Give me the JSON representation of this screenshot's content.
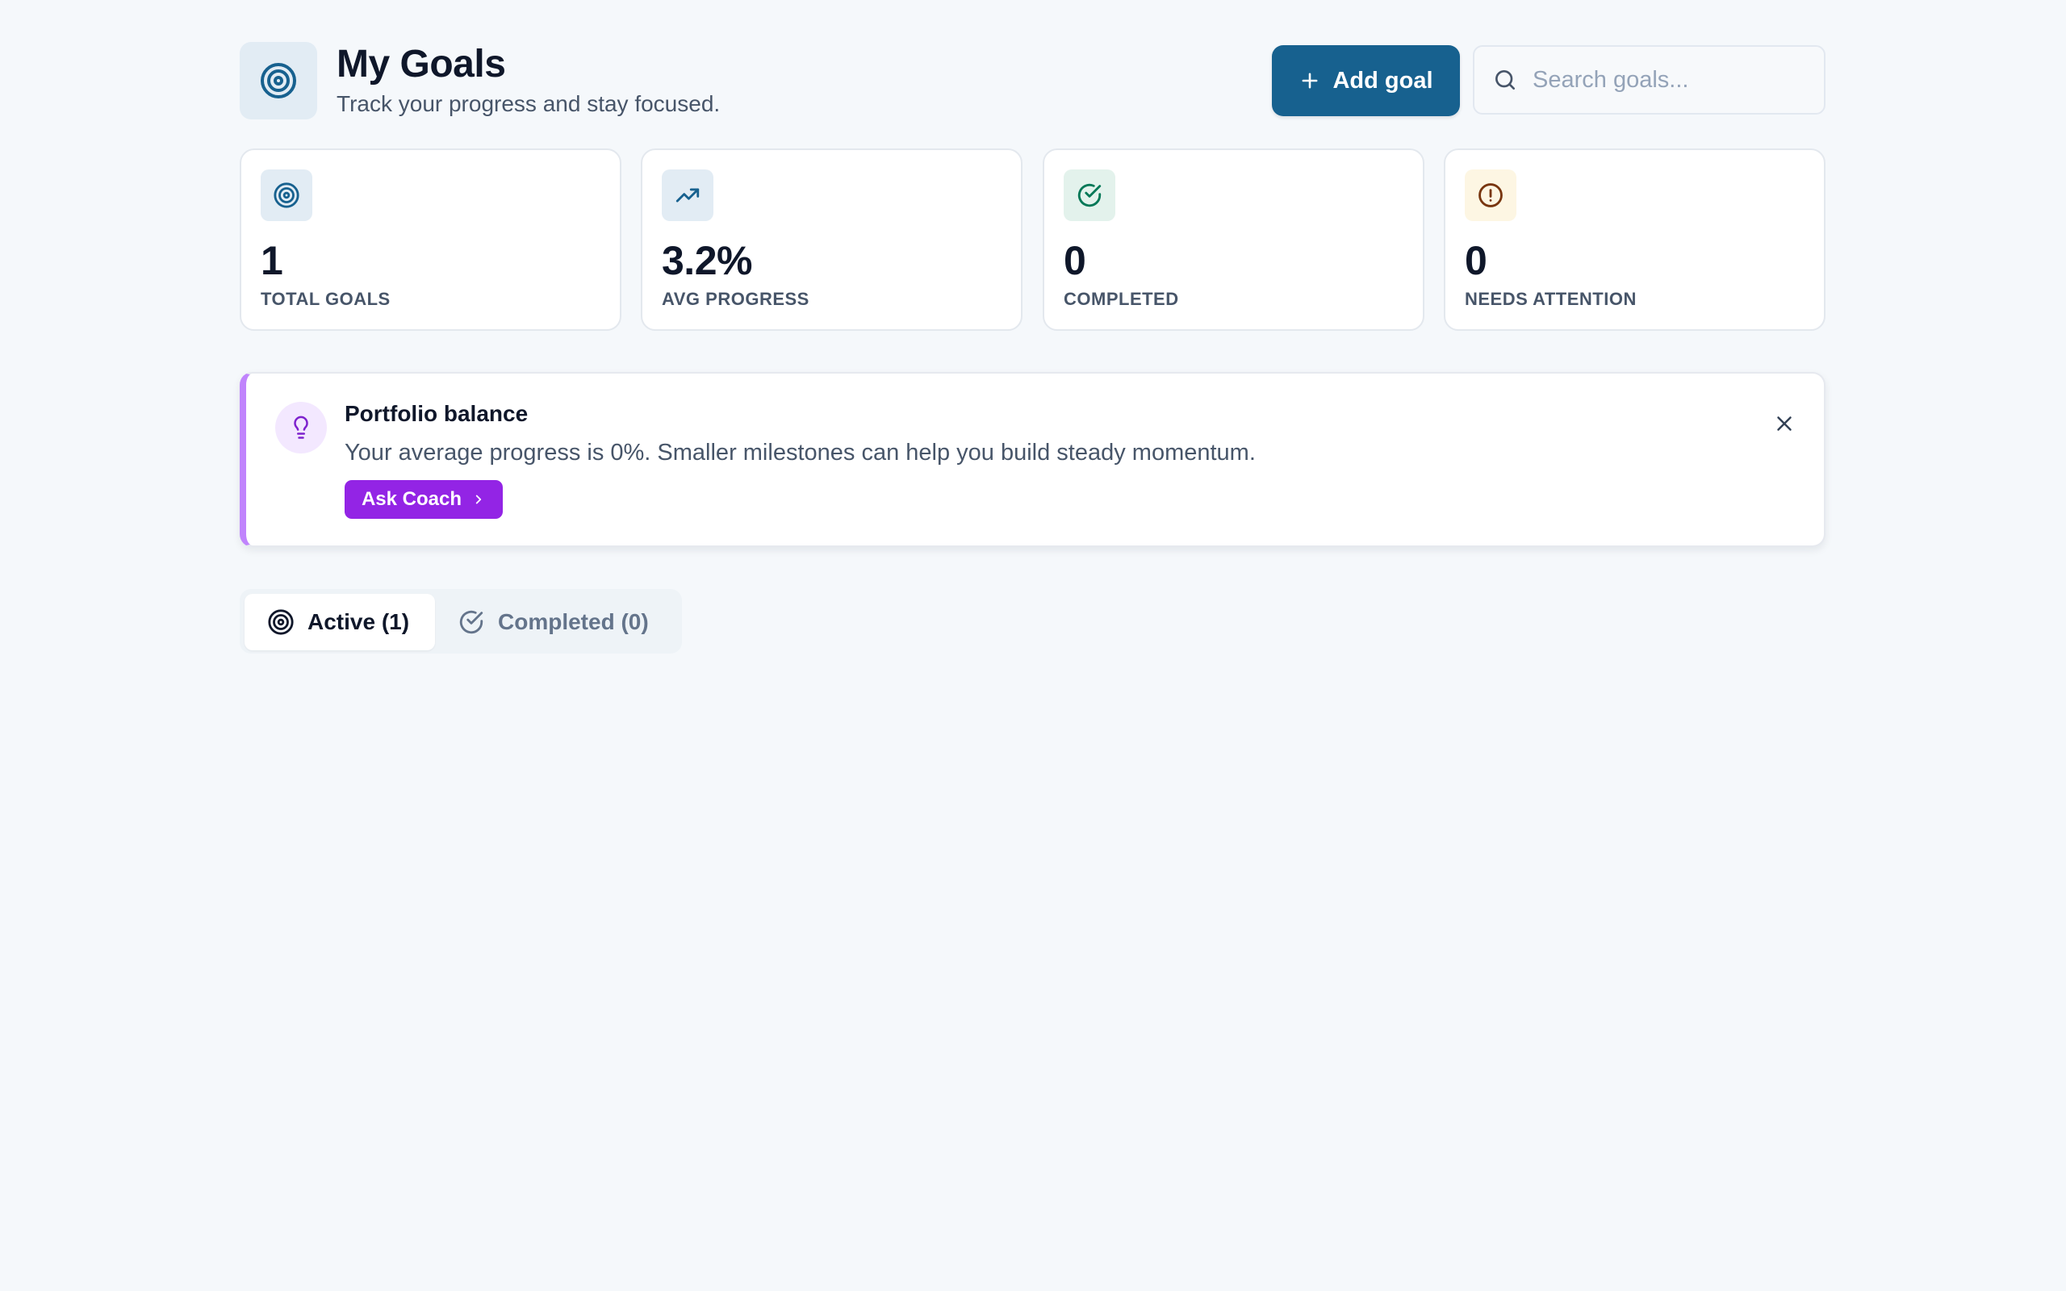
{
  "header": {
    "title": "My Goals",
    "subtitle": "Track your progress and stay focused.",
    "add_label": "Add goal",
    "search_placeholder": "Search goals..."
  },
  "stats": [
    {
      "icon": "target-icon",
      "value": "1",
      "label": "TOTAL GOALS",
      "color": "#17618f",
      "bg": "#e2ecf4"
    },
    {
      "icon": "trending-up-icon",
      "value": "3.2%",
      "label": "AVG PROGRESS",
      "color": "#17618f",
      "bg": "#e2ecf4"
    },
    {
      "icon": "check-circle-icon",
      "value": "0",
      "label": "COMPLETED",
      "color": "#047857",
      "bg": "#e3f2ec"
    },
    {
      "icon": "alert-circle-icon",
      "value": "0",
      "label": "NEEDS ATTENTION",
      "color": "#78350f",
      "bg": "#fdf6e3"
    }
  ],
  "insight": {
    "icon": "lightbulb-icon",
    "title": "Portfolio balance",
    "text": "Your average progress is 0%. Smaller milestones can help you build steady momentum.",
    "button_label": "Ask Coach",
    "accent": "#c084fc"
  },
  "tabs": [
    {
      "icon": "target-icon",
      "label": "Active (1)",
      "active": true
    },
    {
      "icon": "check-circle-icon",
      "label": "Completed (0)",
      "active": false
    }
  ],
  "colors": {
    "primary": "#17618f",
    "coach": "#9324e5",
    "background": "#f5f8fb"
  }
}
